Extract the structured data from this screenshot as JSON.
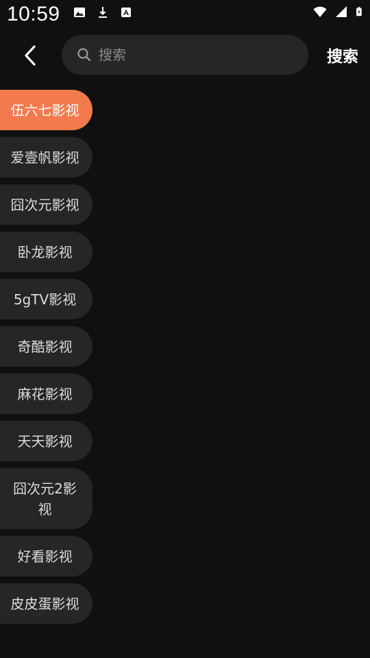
{
  "status_bar": {
    "time": "10:59",
    "left_icons": [
      "image-icon",
      "download-icon",
      "a-icon"
    ],
    "right_icons": [
      "wifi-icon",
      "signal-icon",
      "battery-icon"
    ]
  },
  "search": {
    "placeholder": "搜索",
    "value": "",
    "submit_label": "搜索"
  },
  "sources": [
    {
      "label": "伍六七影视",
      "active": true
    },
    {
      "label": "爱壹帆影视",
      "active": false
    },
    {
      "label": "囧次元影视",
      "active": false
    },
    {
      "label": "卧龙影视",
      "active": false
    },
    {
      "label": "5gTV影视",
      "active": false
    },
    {
      "label": "奇酷影视",
      "active": false
    },
    {
      "label": "麻花影视",
      "active": false
    },
    {
      "label": "天天影视",
      "active": false
    },
    {
      "label": "囧次元2影视",
      "active": false
    },
    {
      "label": "好看影视",
      "active": false
    },
    {
      "label": "皮皮蛋影视",
      "active": false
    }
  ],
  "colors": {
    "background": "#101010",
    "active_accent": "#f27a4d",
    "pill_background": "#262626"
  }
}
